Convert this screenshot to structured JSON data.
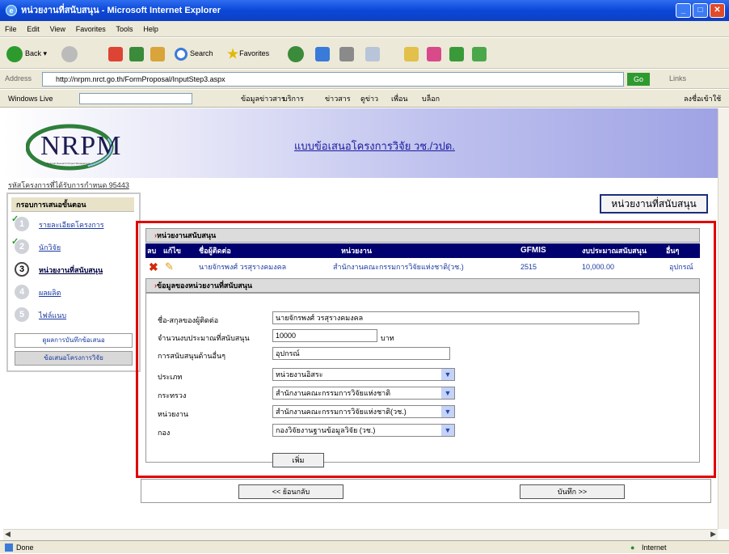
{
  "window": {
    "title": "หน่วยงานที่สนับสนุน - Microsoft Internet Explorer"
  },
  "menu": [
    "File",
    "Edit",
    "View",
    "Favorites",
    "Tools",
    "Help"
  ],
  "toolbar": {
    "back": "Back",
    "search": "Search",
    "favorites": "Favorites"
  },
  "address": {
    "label": "Address",
    "url": "http://nrpm.nrct.go.th/FormProposal/InputStep3.aspx",
    "go": "Go",
    "links": "Links"
  },
  "links_bar": {
    "windows_live": "Windows Live",
    "items": [
      "ข้อมูลข่าวสาร",
      "บริการ",
      "ข่าวสาร",
      "ดูข่าว",
      "เพื่อน",
      "บล็อก"
    ],
    "sign_in": "ลงชื่อเข้าใช้"
  },
  "banner": {
    "logo_text": "NRPM",
    "logo_sub": "National Research Project Management",
    "header_link": "แบบข้อเสนอโครงการวิจัย วช./วปด."
  },
  "project_code": "รหัสโครงการที่ได้รับการกำหนด 95443",
  "leftnav": {
    "header": "กรอบการเสนอขั้นตอน",
    "steps": [
      {
        "num": "1",
        "label": "รายละเอียดโครงการ",
        "done": true
      },
      {
        "num": "2",
        "label": "นักวิจัย",
        "done": true
      },
      {
        "num": "3",
        "label": "หน่วยงานที่สนับสนุน",
        "done": false,
        "active": true
      },
      {
        "num": "4",
        "label": "ผลผลิต",
        "done": false
      },
      {
        "num": "5",
        "label": "ไฟล์แนบ",
        "done": false
      }
    ],
    "buttons": [
      "ดูผลการบันทึกข้อเสนอ",
      "ข้อเสนอโครงการวิจัย"
    ]
  },
  "sponsor_button": "หน่วยงานที่สนับสนุน",
  "panel1": {
    "title": "หน่วยงานสนับสนุน",
    "columns": [
      "ลบ",
      "แก้ไข",
      "ชื่อผู้ติดต่อ",
      "หน่วยงาน",
      "GFMIS",
      "งบประมาณสนับสนุน",
      "อื่นๆ"
    ],
    "row": {
      "contact": "นายจักรพงศ์ วรสุรางคมงคล",
      "agency": "สำนักงานคณะกรรมการวิจัยแห่งชาติ(วช.)",
      "gfmis": "2515",
      "budget": "10,000.00",
      "other": "อุปกรณ์"
    }
  },
  "panel2": {
    "title": "ข้อมูลของหน่วยงานที่สนับสนุน",
    "fields": {
      "contact_label": "ชื่อ-สกุลของผู้ติดต่อ",
      "contact_value": "นายจักรพงศ์ วรสุรางคมงคล",
      "budget_label": "จำนวนงบประมาณที่สนับสนุน",
      "budget_value": "10000",
      "budget_unit": "บาท",
      "other_label": "การสนับสนุนด้านอื่นๆ",
      "other_value": "อุปกรณ์",
      "type_label": "ประเภท",
      "type_value": "หน่วยงานอิสระ",
      "ministry_label": "กระทรวง",
      "ministry_value": "สำนักงานคณะกรรมการวิจัยแห่งชาติ",
      "dept_label": "หน่วยงาน",
      "dept_value": "สำนักงานคณะกรรมการวิจัยแห่งชาติ(วช.)",
      "sub_label": "กอง",
      "sub_value": "กองวิจัยงานฐานข้อมูลวิจัย (วช.)"
    },
    "add_button": "เพิ่ม"
  },
  "nav": {
    "back": "<< ย้อนกลับ",
    "save": "บันทึก >>"
  },
  "status": {
    "left": "Done",
    "zone": "Internet"
  }
}
